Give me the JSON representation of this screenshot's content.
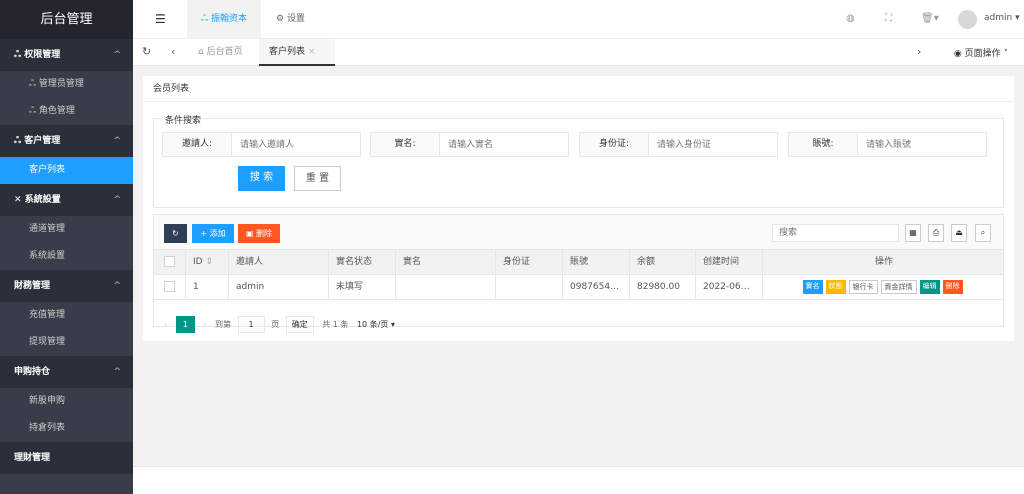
{
  "sidebar": {
    "title": "后台管理",
    "groups": [
      {
        "label": "权限管理",
        "items": [
          "管理员管理",
          "角色管理"
        ]
      },
      {
        "label": "客户管理",
        "items": [
          "客户列表"
        ]
      },
      {
        "label": "系統設置",
        "items": [
          "通道管理",
          "系统設置"
        ]
      },
      {
        "label": "財務管理",
        "items": [
          "充值管理",
          "提现管理"
        ]
      },
      {
        "label": "申购持仓",
        "items": [
          "新股申购",
          "持倉列表"
        ]
      },
      {
        "label": "理財管理",
        "items": []
      }
    ]
  },
  "topbar": {
    "nav1": "振翰资本",
    "nav2": "设置",
    "user": "admin"
  },
  "tabs": {
    "home": "后台首页",
    "current": "客户列表",
    "page_ops": "页面操作"
  },
  "panel": {
    "title": "会员列表",
    "legend": "条件搜索"
  },
  "filters": [
    {
      "label": "邀請人:",
      "placeholder": "请输入邀請人"
    },
    {
      "label": "實名:",
      "placeholder": "请输入實名"
    },
    {
      "label": "身份证:",
      "placeholder": "请输入身份证"
    },
    {
      "label": "賬號:",
      "placeholder": "请输入賬號"
    }
  ],
  "buttons": {
    "search": "搜 索",
    "reset": "重 置",
    "add": "+ 添加",
    "delete": "删除"
  },
  "toolbar": {
    "search_placeholder": "搜索"
  },
  "table": {
    "headers": [
      "ID",
      "邀請人",
      "實名状态",
      "實名",
      "身份证",
      "賬號",
      "余额",
      "创建时间",
      "操作"
    ],
    "rows": [
      {
        "id": "1",
        "inviter": "admin",
        "real_status": "未填写",
        "real_name": "",
        "id_card": "",
        "account": "0987654…",
        "balance": "82980.00",
        "created": "2022-06…"
      }
    ],
    "ops": [
      "實名",
      "狀態",
      "银行卡",
      "資金詳情",
      "编辑",
      "刪除"
    ]
  },
  "pagination": {
    "current": "1",
    "goto_label": "到第",
    "goto_value": "1",
    "page_unit": "页",
    "confirm": "确定",
    "total": "共 1 条",
    "per_page": "10 条/页"
  },
  "colors": {
    "sidebar": "#393d49",
    "active": "#1e9fff",
    "add": "#1e9fff",
    "delete": "#ff5722",
    "ok": "#009688",
    "warn": "#ffb800",
    "dark": "#2f4056"
  }
}
